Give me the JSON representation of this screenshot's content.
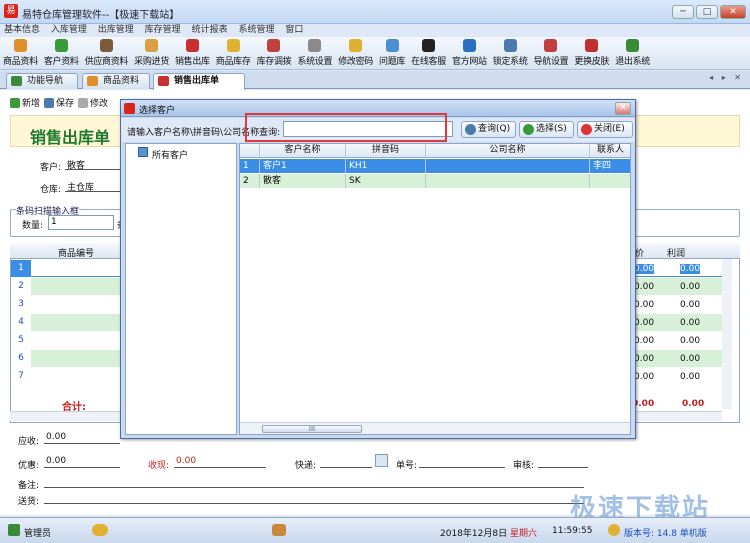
{
  "window": {
    "title": "易特仓库管理软件--【极速下载站】",
    "min_label": "─",
    "max_label": "□",
    "close_label": "✕"
  },
  "menu": [
    "基本信息",
    "入库管理",
    "出库管理",
    "库存管理",
    "统计报表",
    "系统管理",
    "窗口"
  ],
  "toolbar": [
    {
      "label": "商品资料",
      "color": "#e0902a"
    },
    {
      "label": "客户资料",
      "color": "#3a9a3a"
    },
    {
      "label": "供应商资料",
      "color": "#7a5a3a"
    },
    {
      "label": "采购进货",
      "color": "#d8a040"
    },
    {
      "label": "销售出库",
      "color": "#c83030"
    },
    {
      "label": "商品库存",
      "color": "#e0b030"
    },
    {
      "label": "库存调拨",
      "color": "#c04040"
    },
    {
      "label": "系统设置",
      "color": "#8a8a8a"
    },
    {
      "label": "修改密码",
      "color": "#e0b030"
    },
    {
      "label": "问题库",
      "color": "#4a90d0"
    },
    {
      "label": "在线客服",
      "color": "#222222"
    },
    {
      "label": "官方网站",
      "color": "#2a70c0"
    },
    {
      "label": "锁定系统",
      "color": "#4a7ab0"
    },
    {
      "label": "导航设置",
      "color": "#c04040"
    },
    {
      "label": "更换皮肤",
      "color": "#c03030"
    },
    {
      "label": "退出系统",
      "color": "#3a8a3a"
    }
  ],
  "tabs": [
    {
      "label": "功能导航",
      "color": "#3a8a3a"
    },
    {
      "label": "商品资料",
      "color": "#e0902a"
    },
    {
      "label": "销售出库单",
      "color": "#c83030"
    }
  ],
  "nav_arrows": "◂ ▸ ✕",
  "subtool": {
    "new": "新增",
    "save": "保存",
    "edit": "修改"
  },
  "page": {
    "title": "销售出库单",
    "customer_label": "客户:",
    "customer_value": "散客",
    "warehouse_label": "仓库:",
    "warehouse_value": "主仓库",
    "barcode_group": "条码扫描输入框",
    "qty_label": "数量:",
    "qty_value": "1",
    "qty_extra": "条"
  },
  "grid": {
    "col_product": "商品编号",
    "col_profit": "利润",
    "col_partial": "价",
    "rows": [
      {
        "n": "1",
        "a": "0.00",
        "b": "0.00"
      },
      {
        "n": "2",
        "a": "0.00",
        "b": "0.00"
      },
      {
        "n": "3",
        "a": "0.00",
        "b": "0.00"
      },
      {
        "n": "4",
        "a": "0.00",
        "b": "0.00"
      },
      {
        "n": "5",
        "a": "0.00",
        "b": "0.00"
      },
      {
        "n": "6",
        "a": "0.00",
        "b": "0.00"
      },
      {
        "n": "7",
        "a": "0.00",
        "b": "0.00"
      }
    ],
    "total_label": "合计:",
    "total_a": "0.00",
    "total_b": "0.00"
  },
  "bottom": {
    "receivable_label": "应收:",
    "receivable_value": "0.00",
    "discount_label": "优惠:",
    "discount_value": "0.00",
    "received_label": "收现:",
    "received_value": "0.00",
    "express_label": "快递:",
    "tracking_label": "单号:",
    "audit_label": "审核:",
    "note_label": "备注:",
    "delivery_label": "送货:"
  },
  "status": {
    "user": "管理员",
    "date": "2018年12月8日",
    "weekday": "星期六",
    "time": "11:59:55",
    "version": "版本号: 14.8 单机版"
  },
  "watermark": "极速下载站",
  "dialog": {
    "title": "选择客户",
    "close_label": "✕",
    "search_label": "请输入客户名称\\拼音码\\公司名称查询:",
    "search_value": "",
    "btn_query": "查询(Q)",
    "btn_select": "选择(S)",
    "btn_close": "关闭(E)",
    "tree_root": "所有客户",
    "columns": [
      "客户名称",
      "拼音码",
      "公司名称",
      "联系人"
    ],
    "rows": [
      {
        "n": "1",
        "name": "客户1",
        "code": "KH1",
        "company": "",
        "contact": "李四"
      },
      {
        "n": "2",
        "name": "散客",
        "code": "SK",
        "company": "",
        "contact": ""
      }
    ],
    "scroll_thumb": "III"
  }
}
